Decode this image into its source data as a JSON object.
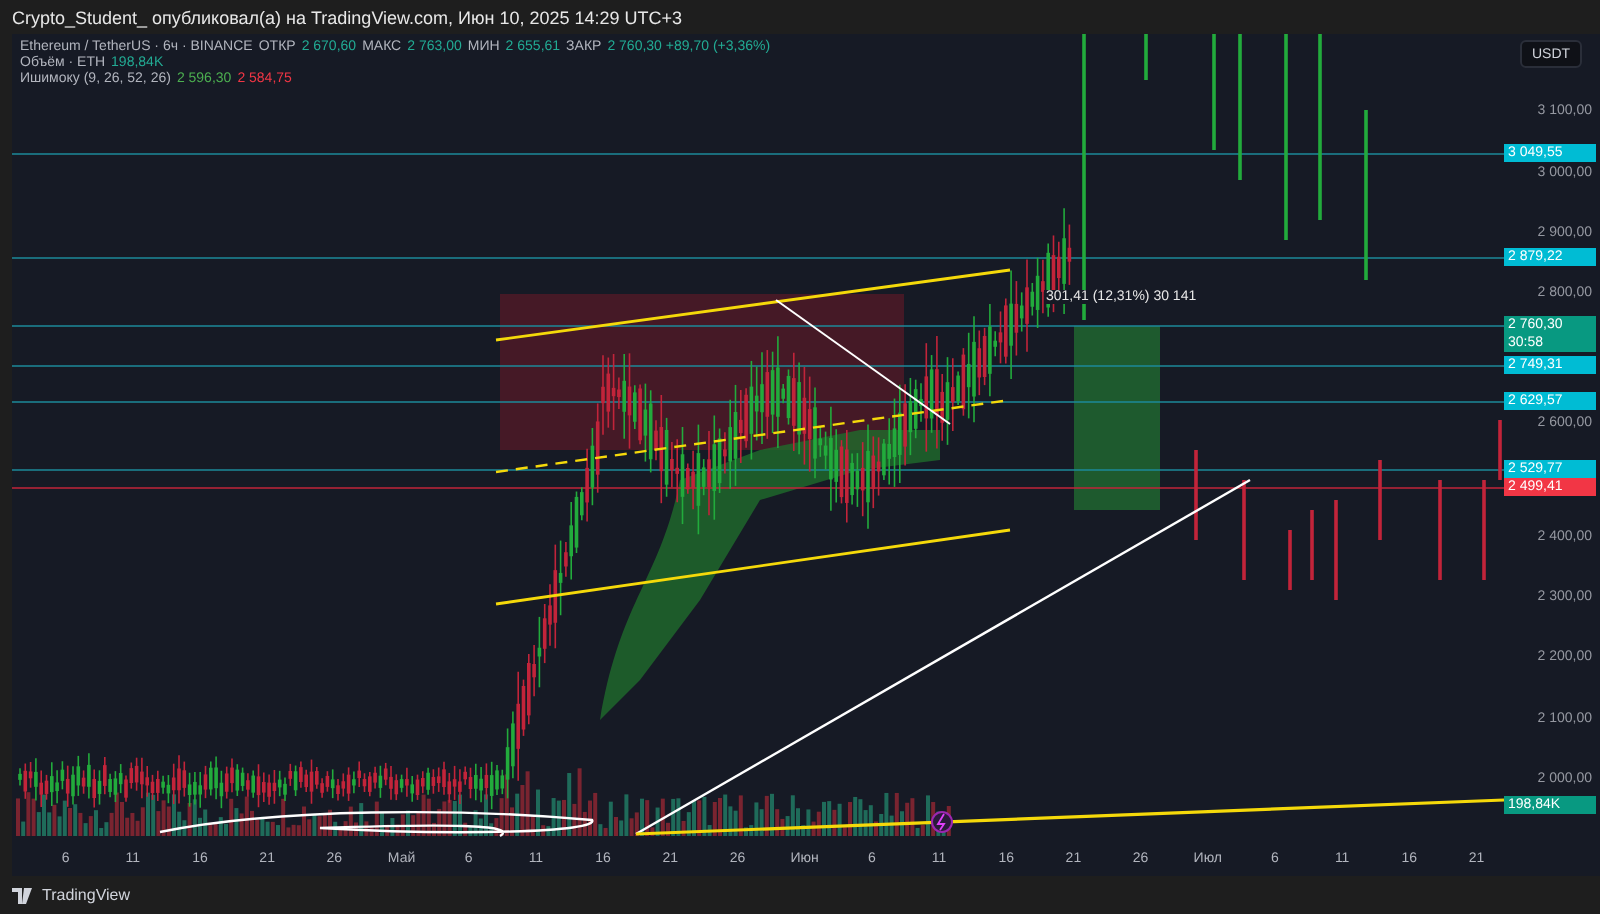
{
  "header": {
    "title": "Crypto_Student_ опубликовал(а) на TradingView.com, Июн 10, 2025 14:29 UTC+3"
  },
  "legend": {
    "symbol": "Ethereum / TetherUS · 6ч · BINANCE",
    "fields": [
      {
        "label": "ОТКР",
        "value": "2 670,60"
      },
      {
        "label": "МАКС",
        "value": "2 763,00"
      },
      {
        "label": "МИН",
        "value": "2 655,61"
      },
      {
        "label": "ЗАКР",
        "value": "2 760,30 +89,70 (+3,36%)"
      }
    ],
    "volume": {
      "label": "Объём · ETH",
      "value": "198,84K"
    },
    "ichimoku": {
      "label": "Ишимоку (9, 26, 52, 26)",
      "values": [
        {
          "text": "2 596,30",
          "color": "#4caf50"
        },
        {
          "text": "2 584,75",
          "color": "#f23645"
        }
      ]
    }
  },
  "currency_button": "USDT",
  "measure_label": "301,41 (12,31%) 30 141",
  "price_axis": [
    "3 100,00",
    "3 000,00",
    "2 900,00",
    "2 800,00",
    "2 600,00",
    "2 400,00",
    "2 300,00",
    "2 200,00",
    "2 100,00",
    "2 000,00"
  ],
  "price_tags": [
    {
      "text": "3 049,55",
      "color": "#00bcd4"
    },
    {
      "text": "2 879,22",
      "color": "#00bcd4"
    },
    {
      "text": "2 760,30",
      "countdown": "30:58",
      "color": "#089981"
    },
    {
      "text": "2 749,31",
      "color": "#00bcd4"
    },
    {
      "text": "2 629,57",
      "color": "#00bcd4"
    },
    {
      "text": "2 529,77",
      "color": "#00bcd4"
    },
    {
      "text": "2 499,41",
      "color": "#f23645"
    },
    {
      "text": "198,84K",
      "color": "#089981"
    }
  ],
  "date_axis": [
    "6",
    "11",
    "16",
    "21",
    "26",
    "Май",
    "6",
    "11",
    "16",
    "21",
    "26",
    "Июн",
    "6",
    "11",
    "16",
    "21",
    "26",
    "Июл",
    "6",
    "11",
    "16",
    "21"
  ],
  "footer": {
    "logo_text": "TradingView"
  }
}
